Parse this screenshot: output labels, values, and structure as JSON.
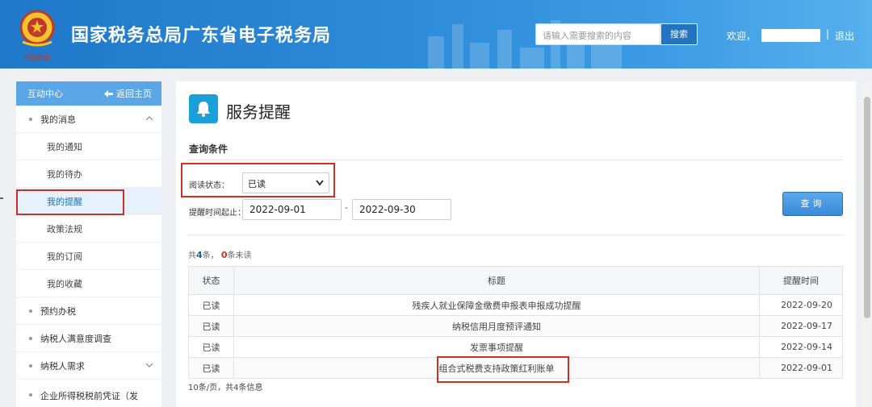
{
  "header": {
    "site_title": "国家税务总局广东省电子税务局",
    "search_placeholder": "请输入需要搜索的内容",
    "search_button": "搜索",
    "welcome": "欢迎，",
    "separator": "|",
    "logout": "退出",
    "brand_color": "#2d8ad8"
  },
  "sidebar": {
    "title": "互动中心",
    "back_label": "返回主页",
    "groups": [
      {
        "label": "我的消息",
        "expanded": true,
        "children": [
          {
            "label": "我的通知",
            "active": false
          },
          {
            "label": "我的待办",
            "active": false
          },
          {
            "label": "我的提醒",
            "active": true
          },
          {
            "label": "政策法规",
            "active": false
          },
          {
            "label": "我的订阅",
            "active": false
          },
          {
            "label": "我的收藏",
            "active": false
          }
        ]
      },
      {
        "label": "预约办税"
      },
      {
        "label": "纳税人满意度调查"
      },
      {
        "label": "纳税人需求",
        "collapsed_chevron": true
      },
      {
        "label": "企业所得税税前凭证（发"
      }
    ]
  },
  "main": {
    "page_icon": "bell-icon",
    "title": "服务提醒",
    "conditions_title": "查询条件",
    "read_status_label": "阅读状态：",
    "read_status_value": "已读",
    "time_range_label": "提醒时间起止：",
    "date_from": "2022-09-01",
    "date_to": "2022-09-30",
    "date_dash": "-",
    "query_button": "查询",
    "summary": {
      "prefix": "共",
      "total": "4",
      "total_suffix": "条，",
      "unread": "0",
      "unread_suffix": "条未读"
    },
    "table": {
      "headers": [
        "状态",
        "标题",
        "提醒时间"
      ],
      "rows": [
        {
          "status": "已读",
          "title": "残疾人就业保障金缴费申报表申报成功提醒",
          "date": "2022-09-20"
        },
        {
          "status": "已读",
          "title": "纳税信用月度预评通知",
          "date": "2022-09-17"
        },
        {
          "status": "已读",
          "title": "发票事项提醒",
          "date": "2022-09-14"
        },
        {
          "status": "已读",
          "title": "组合式税费支持政策红利账单",
          "date": "2022-09-01"
        }
      ]
    },
    "pager_text": "10条/页，共4条信息",
    "highlight_color": "#c9302c"
  }
}
